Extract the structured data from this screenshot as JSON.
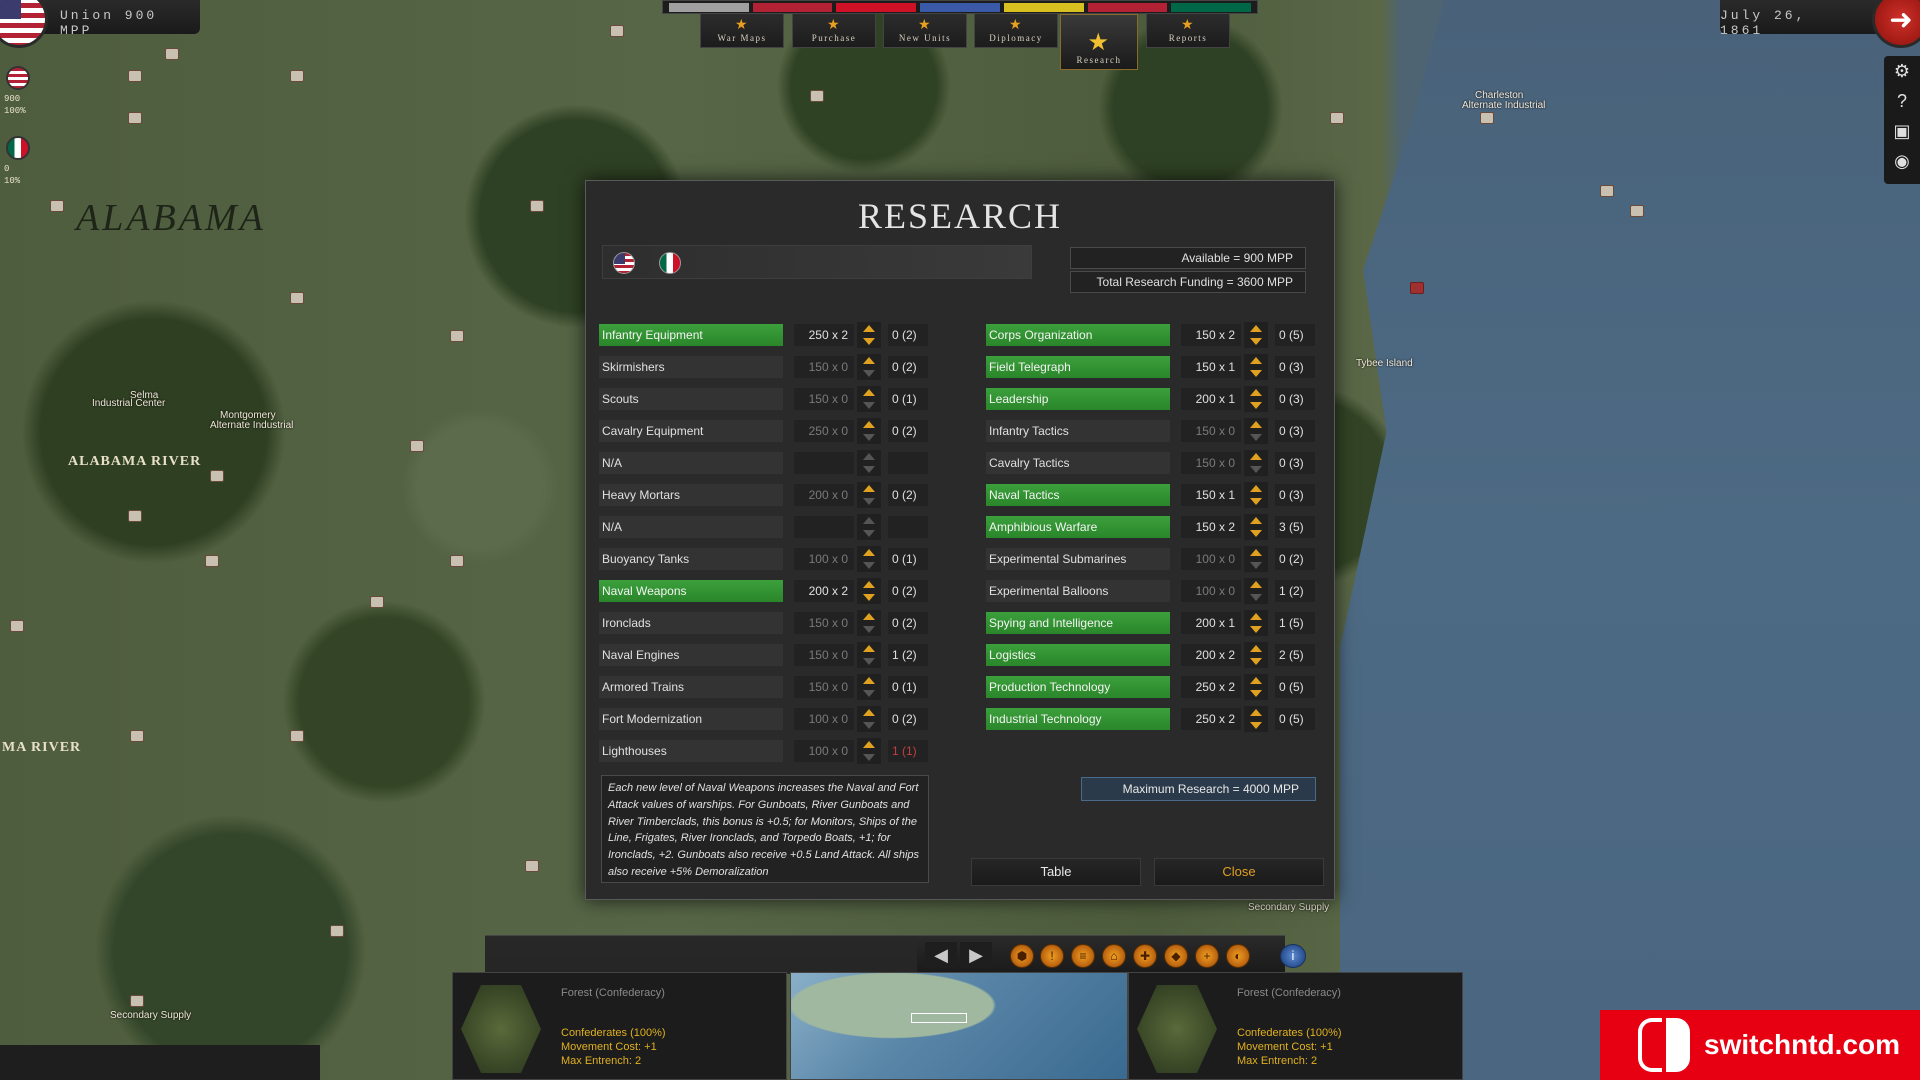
{
  "top": {
    "mpp": "Union 900 MPP",
    "date": "July 26, 1861",
    "tabs": [
      {
        "label": "War Maps",
        "active": false
      },
      {
        "label": "Purchase",
        "active": false
      },
      {
        "label": "New Units",
        "active": false
      },
      {
        "label": "Diplomacy",
        "active": false
      },
      {
        "label": "Research",
        "active": true
      },
      {
        "label": "Reports",
        "active": false
      }
    ],
    "flags_strip_colors": [
      "#a0a0a0",
      "#b22234",
      "#ce1126",
      "#3a5aa8",
      "#d8c020",
      "#b22234",
      "#006847"
    ]
  },
  "side": {
    "us_value": "900",
    "us_percent": "100%",
    "mx_value": "0",
    "mx_percent": "10%"
  },
  "map": {
    "state_label": "ALABAMA",
    "river1": "ALABAMA RIVER",
    "river2": "MA RIVER",
    "cities": [
      "Selma",
      "Industrial Center",
      "Montgomery",
      "Alternate Industrial",
      "Charleston",
      "Alternate Industrial",
      "Tybee Island",
      "Secondary Supply",
      "Secondary Supply"
    ]
  },
  "research": {
    "title": "RESEARCH",
    "available": "Available =  900 MPP",
    "funding": "Total Research Funding =  3600 MPP",
    "left_techs": [
      {
        "name": "Infantry Equipment",
        "cost": "250 x 2",
        "level": "0 (2)",
        "active": true,
        "alert": false
      },
      {
        "name": "Skirmishers",
        "cost": "150 x 0",
        "level": "0 (2)",
        "active": false,
        "alert": false
      },
      {
        "name": "Scouts",
        "cost": "150 x 0",
        "level": "0 (1)",
        "active": false,
        "alert": false
      },
      {
        "name": "Cavalry Equipment",
        "cost": "250 x 0",
        "level": "0 (2)",
        "active": false,
        "alert": false
      },
      {
        "name": "N/A",
        "cost": "",
        "level": "",
        "active": false,
        "alert": false
      },
      {
        "name": "Heavy Mortars",
        "cost": "200 x 0",
        "level": "0 (2)",
        "active": false,
        "alert": false
      },
      {
        "name": "N/A",
        "cost": "",
        "level": "",
        "active": false,
        "alert": false
      },
      {
        "name": "Buoyancy Tanks",
        "cost": "100 x 0",
        "level": "0 (1)",
        "active": false,
        "alert": false
      },
      {
        "name": "Naval Weapons",
        "cost": "200 x 2",
        "level": "0 (2)",
        "active": true,
        "alert": false
      },
      {
        "name": "Ironclads",
        "cost": "150 x 0",
        "level": "0 (2)",
        "active": false,
        "alert": false
      },
      {
        "name": "Naval Engines",
        "cost": "150 x 0",
        "level": "1 (2)",
        "active": false,
        "alert": false
      },
      {
        "name": "Armored Trains",
        "cost": "150 x 0",
        "level": "0 (1)",
        "active": false,
        "alert": false
      },
      {
        "name": "Fort Modernization",
        "cost": "100 x 0",
        "level": "0 (2)",
        "active": false,
        "alert": false
      },
      {
        "name": "Lighthouses",
        "cost": "100 x 0",
        "level": "1 (1)",
        "active": false,
        "alert": true
      }
    ],
    "right_techs": [
      {
        "name": "Corps Organization",
        "cost": "150 x 2",
        "level": "0 (5)",
        "active": true
      },
      {
        "name": "Field Telegraph",
        "cost": "150 x 1",
        "level": "0 (3)",
        "active": true
      },
      {
        "name": "Leadership",
        "cost": "200 x 1",
        "level": "0 (3)",
        "active": true
      },
      {
        "name": "Infantry Tactics",
        "cost": "150 x 0",
        "level": "0 (3)",
        "active": false
      },
      {
        "name": "Cavalry Tactics",
        "cost": "150 x 0",
        "level": "0 (3)",
        "active": false
      },
      {
        "name": "Naval Tactics",
        "cost": "150 x 1",
        "level": "0 (3)",
        "active": true
      },
      {
        "name": "Amphibious Warfare",
        "cost": "150 x 2",
        "level": "3 (5)",
        "active": true
      },
      {
        "name": "Experimental Submarines",
        "cost": "100 x 0",
        "level": "0 (2)",
        "active": false
      },
      {
        "name": "Experimental Balloons",
        "cost": "100 x 0",
        "level": "1 (2)",
        "active": false
      },
      {
        "name": "Spying and Intelligence",
        "cost": "200 x 1",
        "level": "1 (5)",
        "active": true
      },
      {
        "name": "Logistics",
        "cost": "200 x 2",
        "level": "2 (5)",
        "active": true
      },
      {
        "name": "Production Technology",
        "cost": "250 x 2",
        "level": "0 (5)",
        "active": true
      },
      {
        "name": "Industrial Technology",
        "cost": "250 x 2",
        "level": "0 (5)",
        "active": true
      }
    ],
    "description": "Each new level of Naval Weapons increases the Naval and Fort Attack values of warships.  For Gunboats, River Gunboats and River Timberclads, this bonus is +0.5; for Monitors, Ships of the Line, Frigates, River Ironclads, and Torpedo Boats, +1; for Ironclads, +2.  Gunboats also receive +0.5 Land Attack.  All ships also receive +5% Demoralization",
    "max_research": "Maximum Research =  4000 MPP",
    "table_label": "Table",
    "close_label": "Close"
  },
  "bottom": {
    "left_hex": {
      "title": "Forest (Confederacy)",
      "line1": "Confederates (100%)",
      "line2": "Movement Cost: +1",
      "line3": "Max Entrench: 2"
    },
    "right_hex": {
      "title": "Forest (Confederacy)",
      "line1": "Confederates (100%)",
      "line2": "Movement Cost: +1",
      "line3": "Max Entrench: 2"
    }
  },
  "watermark": "switchntd.com",
  "colors": {
    "active_tech": "#3ba03b",
    "accent_orange": "#e0a020",
    "alert_red": "#c04040"
  }
}
